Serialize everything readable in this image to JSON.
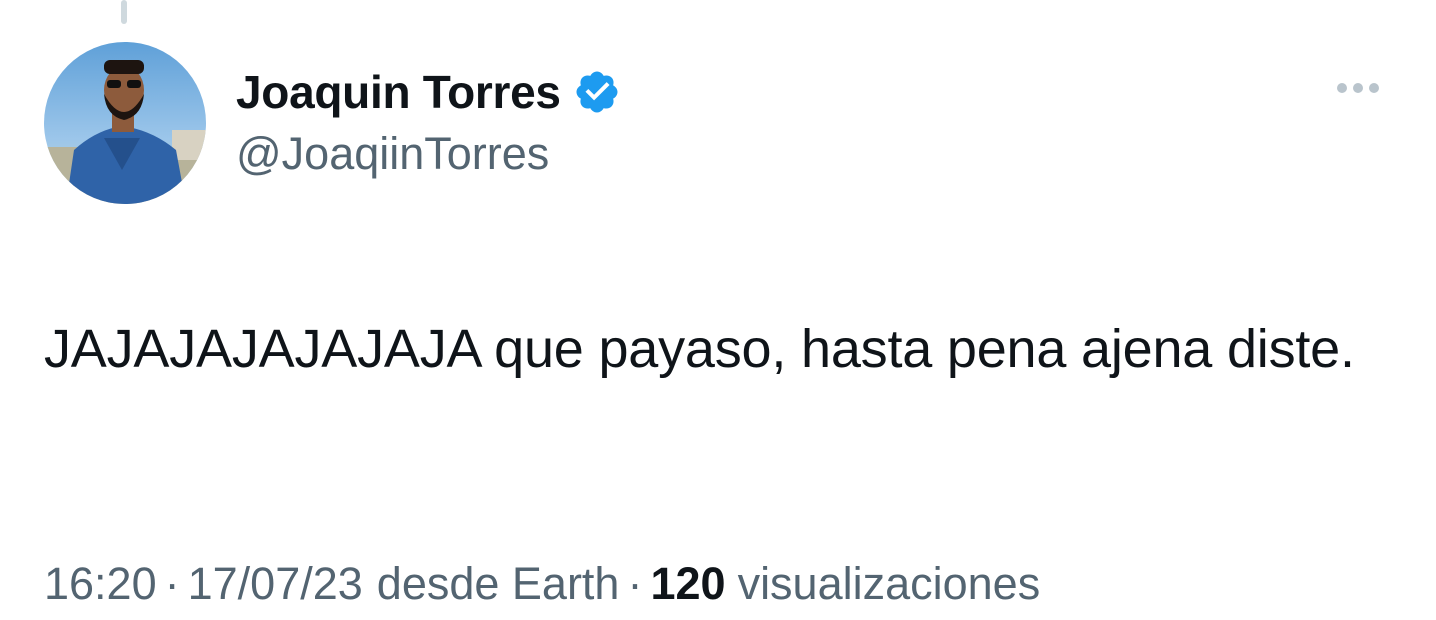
{
  "tweet": {
    "author": {
      "display_name": "Joaquin Torres",
      "handle": "@JoaqiinTorres",
      "verified": true,
      "verified_icon": "verified-badge-icon",
      "avatar_icon": "profile-photo"
    },
    "text": "JAJAJAJAJAJAJA que payaso, hasta pena ajena diste.",
    "meta": {
      "time": "16:20",
      "date": "17/07/23",
      "source": "desde Earth",
      "separator": "·",
      "views_count": "120",
      "views_label": "visualizaciones"
    },
    "more_icon": "more-options-icon"
  },
  "colors": {
    "text_primary": "#0f1419",
    "text_secondary": "#536471",
    "verified_blue": "#1d9bf0",
    "background": "#ffffff"
  }
}
